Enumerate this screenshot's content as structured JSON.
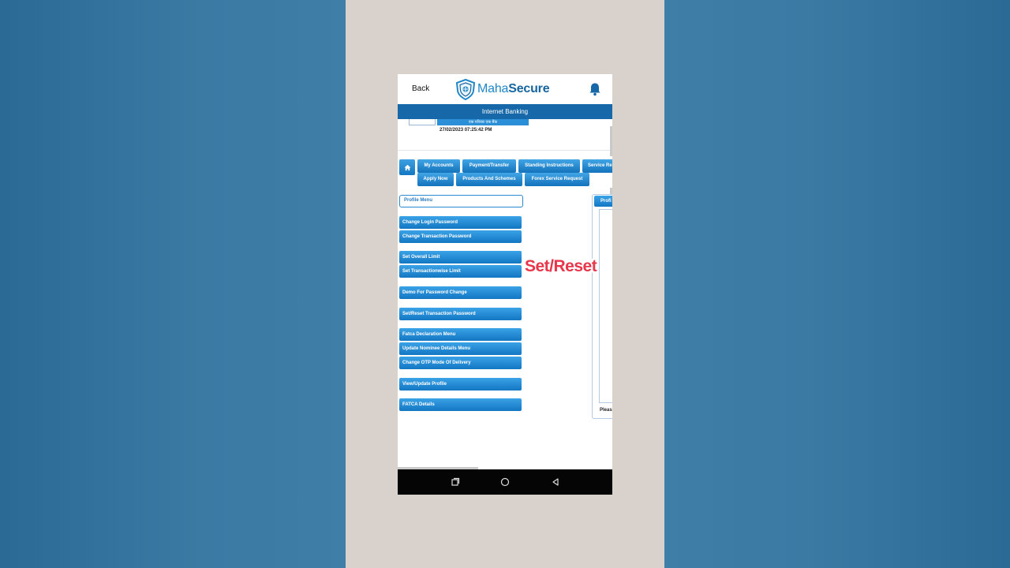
{
  "header": {
    "back_label": "Back",
    "logo_text_light": "Maha",
    "logo_text_bold": "Secure"
  },
  "banner": {
    "title": "Internet Banking",
    "tagline": "एक परिवार एक बैंक",
    "datetime": "27/02/2023 07:25:42 PM"
  },
  "nav": {
    "row1": [
      "My Accounts",
      "Payment/Transfer",
      "Standing Instructions",
      "Service Re"
    ],
    "row2": [
      "Apply Now",
      "Products And Schemes",
      "Forex Service Request"
    ]
  },
  "profile_menu": {
    "header": "Profile Menu",
    "items": [
      "Change Login Password",
      "Change Transaction Password",
      "Set Overall Limit",
      "Set Transactionwise Limit",
      "Demo For Password Change",
      "Set/Reset Transaction Password",
      "Fatca Declaration Menu",
      "Update Nominee Details Menu",
      "Change OTP Mode Of Delivery",
      "View/Update Profile",
      "FATCA Details"
    ]
  },
  "right_panel": {
    "tab_label": "Profi",
    "note": "Pleas"
  },
  "overlay": {
    "caption": "Set/Reset"
  },
  "colors": {
    "primary_blue": "#1668a8",
    "button_blue": "#1377c3",
    "caption_red": "#e8364a",
    "background_blue": "#3f7ea6"
  },
  "icons": {
    "home": "home-icon",
    "bell": "bell-icon",
    "android_recents": "recents-square-icon",
    "android_home": "home-circle-icon",
    "android_back": "back-triangle-icon"
  }
}
